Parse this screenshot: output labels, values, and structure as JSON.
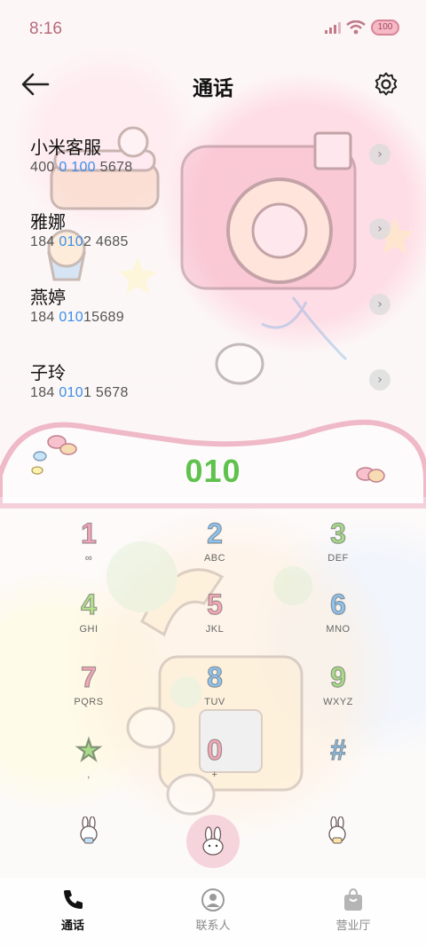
{
  "status_bar": {
    "time": "8:16",
    "battery": "100"
  },
  "header": {
    "title": "通话"
  },
  "recent_calls": [
    {
      "name": "小米客服",
      "num_parts": [
        "400 ",
        "0 100",
        " 5678"
      ]
    },
    {
      "name": "雅娜",
      "num_parts": [
        "184 ",
        "010",
        "2 4685"
      ]
    },
    {
      "name": "燕婷",
      "num_parts": [
        "184 ",
        "010",
        "15689"
      ]
    },
    {
      "name": "子玲",
      "num_parts": [
        "184 ",
        "010",
        "1 5678"
      ]
    }
  ],
  "dialer": {
    "input": "010",
    "keys": [
      {
        "digit": "1",
        "sub": "∞",
        "color": "#f2a6b8"
      },
      {
        "digit": "2",
        "sub": "ABC",
        "color": "#8fc3ee"
      },
      {
        "digit": "3",
        "sub": "DEF",
        "color": "#a9d98a"
      },
      {
        "digit": "4",
        "sub": "GHI",
        "color": "#b6e08f"
      },
      {
        "digit": "5",
        "sub": "JKL",
        "color": "#f3a9b8"
      },
      {
        "digit": "6",
        "sub": "MNO",
        "color": "#8fc3ee"
      },
      {
        "digit": "7",
        "sub": "PQRS",
        "color": "#f3a9b8"
      },
      {
        "digit": "8",
        "sub": "TUV",
        "color": "#8fc3ee"
      },
      {
        "digit": "9",
        "sub": "WXYZ",
        "color": "#a9d98a"
      },
      {
        "digit": "★",
        "sub": ",",
        "color": "#a9d98a"
      },
      {
        "digit": "0",
        "sub": "+",
        "color": "#f3a9b8"
      },
      {
        "digit": "#",
        "sub": "",
        "color": "#8fc3ee"
      }
    ]
  },
  "bottom_nav": [
    {
      "label": "通话",
      "icon": "phone-icon",
      "active": true
    },
    {
      "label": "联系人",
      "icon": "contact-icon",
      "active": false
    },
    {
      "label": "营业厅",
      "icon": "store-bag-icon",
      "active": false
    }
  ],
  "colors": {
    "highlight": "#3b8ee8",
    "input": "#5ec24d",
    "accent_pink": "#f3a9b8"
  }
}
